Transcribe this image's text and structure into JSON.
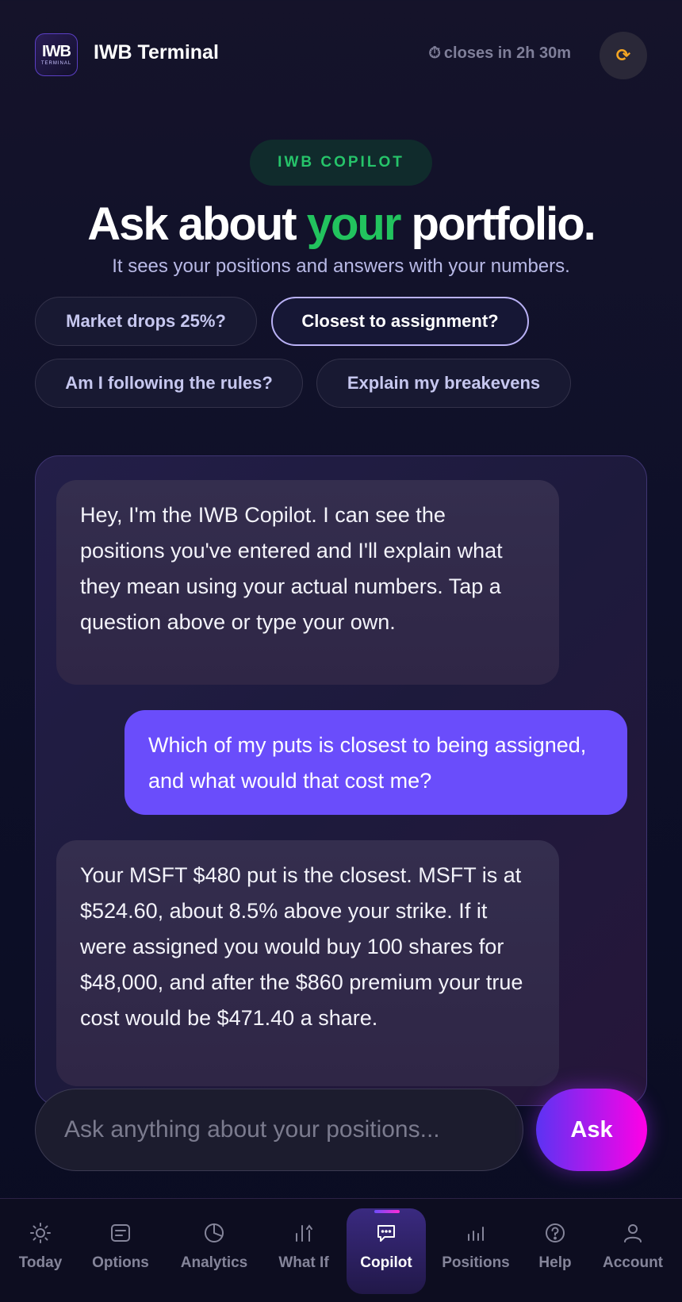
{
  "header": {
    "logo_mark": "IWB",
    "logo_sub": "TERMINAL",
    "brand": "IWB Terminal",
    "timer_icon": "⏱",
    "timer": "closes in 2h 30m",
    "refresh_icon": "⟳"
  },
  "hero": {
    "badge": "IWB COPILOT",
    "title_pre": "Ask about ",
    "title_highlight": "your",
    "title_post": " portfolio.",
    "subtitle": "It sees your positions and answers with your numbers.",
    "highlight_color": "#22c35e"
  },
  "suggestions": [
    {
      "label": "Market drops 25%?"
    },
    {
      "label": "Closest to assignment?"
    },
    {
      "label": "Am I following the rules?"
    },
    {
      "label": "Explain my breakevens"
    }
  ],
  "messages": [
    {
      "role": "bot",
      "text": "Hey, I'm the IWB Copilot. I can see the positions you've entered and I'll explain what they mean using your actual numbers. Tap a question above or type your own."
    },
    {
      "role": "user",
      "text": "Which of my puts is closest to being assigned, and what would that cost me?"
    },
    {
      "role": "bot",
      "text": "Your MSFT $480 put is the closest. MSFT is at $524.60, about 8.5% above your strike. If it were assigned you would buy 100 shares for $48,000, and after the $860 premium your true cost would be $471.40 a share."
    }
  ],
  "composer": {
    "placeholder": "Ask anything about your positions...",
    "value": "",
    "ask_label": "Ask"
  },
  "nav": {
    "active": "Copilot",
    "items": [
      {
        "label": "Today",
        "icon": "sun-icon"
      },
      {
        "label": "Options",
        "icon": "options-icon"
      },
      {
        "label": "Analytics",
        "icon": "pie-chart-icon"
      },
      {
        "label": "What If",
        "icon": "bars-arrow-icon"
      },
      {
        "label": "Copilot",
        "icon": "chat-icon"
      },
      {
        "label": "Positions",
        "icon": "bar-chart-icon"
      },
      {
        "label": "Help",
        "icon": "help-icon"
      },
      {
        "label": "Account",
        "icon": "user-icon"
      }
    ]
  },
  "colors": {
    "accent_purple": "#6a4dfb",
    "accent_pink": "#ff00e6",
    "timer_icon_color": "#f5a623"
  }
}
